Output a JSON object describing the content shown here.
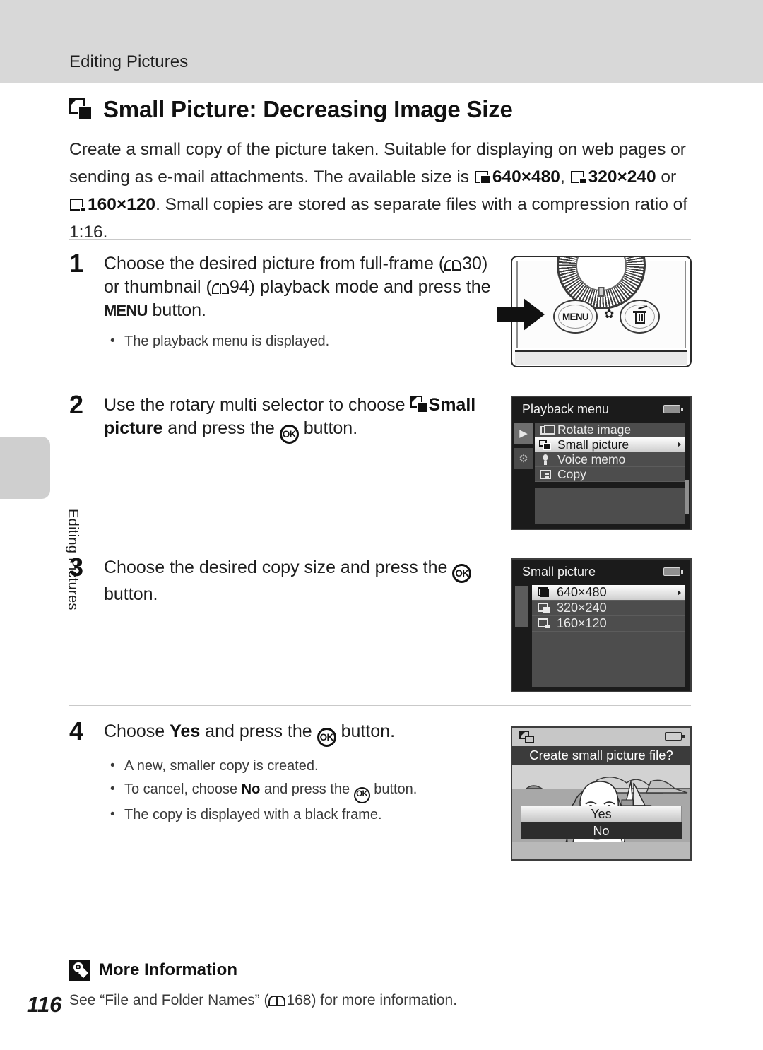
{
  "running_head": "Editing Pictures",
  "side_tab_label": "Editing Pictures",
  "page_number": "116",
  "chapter": {
    "icon": "small-picture-icon",
    "title": "Small Picture: Decreasing Image Size"
  },
  "intro": {
    "part1": "Create a small copy of the picture taken. Suitable for displaying on web pages or sending as e-mail attachments. The available size is ",
    "size1": "640×480",
    "sep1": ", ",
    "size2": "320×240",
    "sep2": " or ",
    "size3": "160×120",
    "part2": ". Small copies are stored as separate files with a compression ratio of 1:16."
  },
  "steps": [
    {
      "number": "1",
      "head_a": "Choose the desired picture from full-frame (",
      "ref_a": "30",
      "head_b": ") or thumbnail (",
      "ref_b": "94",
      "head_c": ") playback mode and press the ",
      "menu_word": "MENU",
      "head_d": " button.",
      "bullets": [
        "The playback menu is displayed."
      ]
    },
    {
      "number": "2",
      "head_a": "Use the rotary multi selector to choose ",
      "bold_a": "Small picture",
      "head_b": " and press the ",
      "ok": "OK",
      "head_c": " button.",
      "bullets": []
    },
    {
      "number": "3",
      "head_a": "Choose the desired copy size and press the ",
      "ok": "OK",
      "head_b": " button.",
      "bullets": []
    },
    {
      "number": "4",
      "head_a": "Choose ",
      "bold_a": "Yes",
      "head_b": " and press the ",
      "ok": "OK",
      "head_c": " button.",
      "bullets": [
        {
          "t1": "A new, smaller copy is created.",
          "b1": "",
          "t2": ""
        },
        {
          "t1": "To cancel, choose ",
          "b1": "No",
          "t2": " and press the ",
          "ok": "OK",
          "t3": " button."
        },
        {
          "t1": "The copy is displayed with a black frame.",
          "b1": "",
          "t2": ""
        }
      ]
    }
  ],
  "camera_art": {
    "menu_button_label": "MENU",
    "macro_icon": "macro-flower-icon",
    "delete_icon": "trash-delete-icon",
    "arrow_icon": "pointer-arrow-icon",
    "dial_icon": "rotary-multi-selector-dial"
  },
  "playback_menu": {
    "title": "Playback menu",
    "battery_icon": "battery-icon",
    "rail": [
      {
        "icon": "playback-tab-icon",
        "active": true
      },
      {
        "icon": "setup-wrench-tab-icon",
        "active": false
      }
    ],
    "items": [
      {
        "label": "Rotate image",
        "icon": "rotate-image-icon",
        "selected": false
      },
      {
        "label": "Small picture",
        "icon": "small-picture-icon",
        "selected": true
      },
      {
        "label": "Voice memo",
        "icon": "voice-memo-mic-icon",
        "selected": false
      },
      {
        "label": "Copy",
        "icon": "copy-icon",
        "selected": false
      }
    ]
  },
  "small_picture_menu": {
    "title": "Small picture",
    "battery_icon": "battery-icon",
    "items": [
      {
        "label": "640×480",
        "icon": "size-large-icon",
        "selected": true
      },
      {
        "label": "320×240",
        "icon": "size-medium-icon",
        "selected": false
      },
      {
        "label": "160×120",
        "icon": "size-small-icon",
        "selected": false
      }
    ]
  },
  "confirm_screen": {
    "mode_icon": "small-picture-icon",
    "battery_icon": "battery-icon",
    "question": "Create small picture file?",
    "options": [
      {
        "label": "Yes",
        "selected": true
      },
      {
        "label": "No",
        "selected": false
      }
    ]
  },
  "more_information": {
    "icon": "lightbulb-icon",
    "title": "More Information",
    "body_a": "See “File and Folder Names” (",
    "ref": "168",
    "body_b": ") for more information."
  }
}
